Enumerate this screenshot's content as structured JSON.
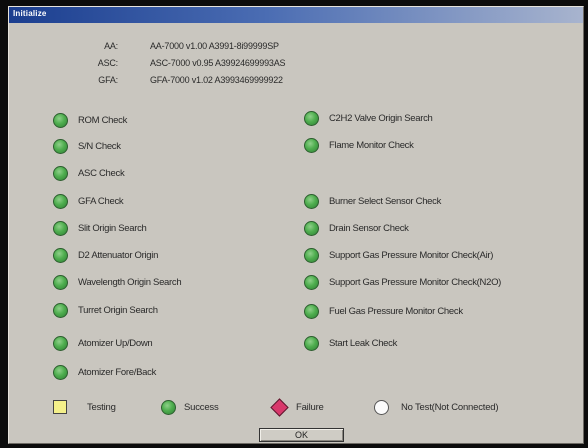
{
  "window": {
    "title": "Initialize"
  },
  "versions": [
    {
      "label": "AA:",
      "value": "AA-7000 v1.00 A3991-8i99999SP"
    },
    {
      "label": "ASC:",
      "value": "ASC-7000 v0.95 A39924699993AS"
    },
    {
      "label": "GFA:",
      "value": "GFA-7000 v1.02 A3993469999922"
    }
  ],
  "checks_left": [
    {
      "label": "ROM Check",
      "status": "success"
    },
    {
      "label": "S/N Check",
      "status": "success"
    },
    {
      "label": "ASC Check",
      "status": "success"
    },
    {
      "label": "GFA Check",
      "status": "success"
    },
    {
      "label": "Slit Origin Search",
      "status": "success"
    },
    {
      "label": "D2 Attenuator Origin",
      "status": "success"
    },
    {
      "label": "Wavelength Origin Search",
      "status": "success"
    },
    {
      "label": "Turret Origin Search",
      "status": "success"
    },
    {
      "label": "Atomizer Up/Down",
      "status": "success"
    },
    {
      "label": "Atomizer Fore/Back",
      "status": "success"
    }
  ],
  "checks_right": [
    {
      "label": "C2H2 Valve Origin Search",
      "status": "success"
    },
    {
      "label": "Flame Monitor Check",
      "status": "success"
    },
    {
      "label": "Burner Select Sensor Check",
      "status": "success"
    },
    {
      "label": "Drain Sensor Check",
      "status": "success"
    },
    {
      "label": "Support Gas Pressure Monitor Check(Air)",
      "status": "success"
    },
    {
      "label": "Support Gas Pressure Monitor Check(N2O)",
      "status": "success"
    },
    {
      "label": "Fuel Gas Pressure Monitor Check",
      "status": "success"
    },
    {
      "label": "Start Leak Check",
      "status": "success"
    }
  ],
  "legend": {
    "testing": "Testing",
    "success": "Success",
    "failure": "Failure",
    "no_test": "No Test(Not Connected)"
  },
  "ok_button": "OK",
  "colors": {
    "success": "#4fae4f",
    "testing": "#f4f08a",
    "failure": "#d8386b",
    "no_test": "#fbfbfb"
  }
}
